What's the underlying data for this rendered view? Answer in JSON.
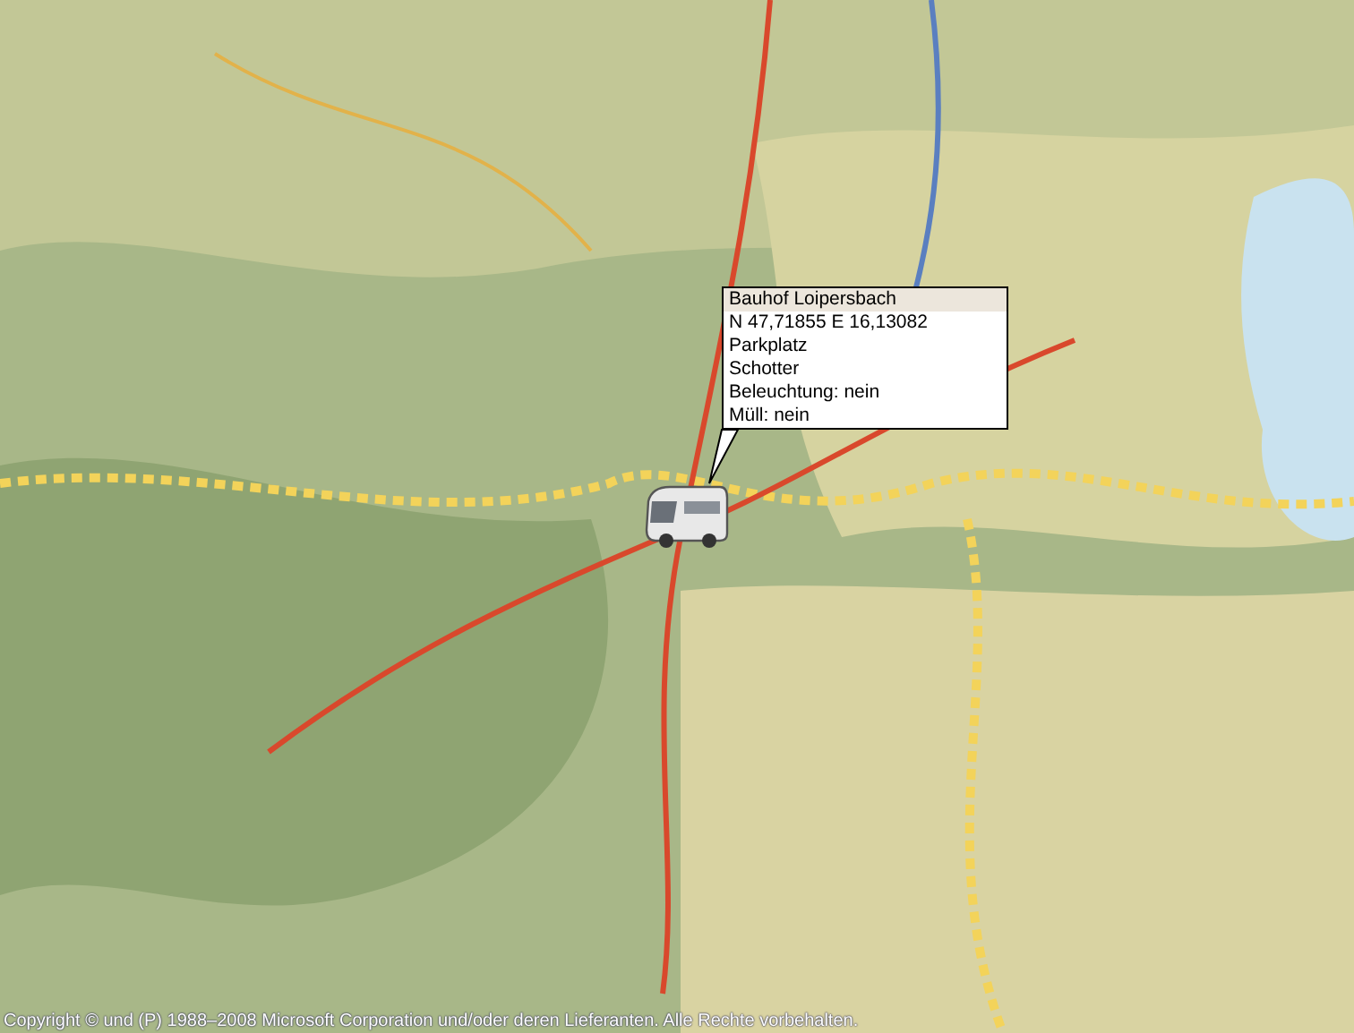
{
  "popup": {
    "title": "Bauhof Loipersbach",
    "lines": [
      "N 47,71855 E 16,13082",
      "Parkplatz",
      "Schotter",
      "Beleuchtung: nein",
      "Müll: nein"
    ]
  },
  "copyright": "Copyright © und (P) 1988–2008 Microsoft Corporation und/oder deren Lieferanten. Alle Rechte vorbehalten."
}
